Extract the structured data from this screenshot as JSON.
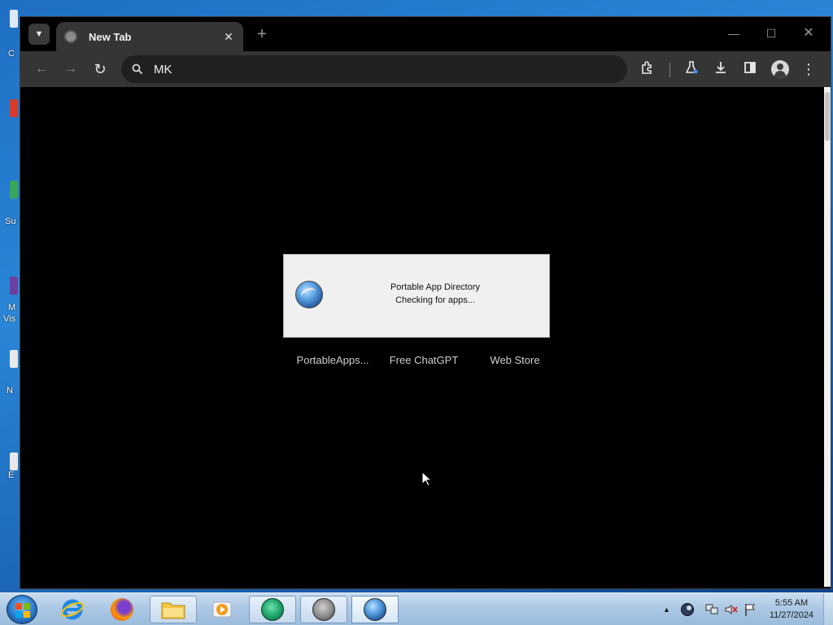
{
  "desktop": {
    "icons": [
      {
        "label": "C"
      },
      {
        "label": ""
      },
      {
        "label": "Su"
      },
      {
        "label": "M"
      },
      {
        "label": "Vis"
      },
      {
        "label": "N"
      },
      {
        "label": "E"
      }
    ]
  },
  "browser": {
    "tab": {
      "title": "New Tab",
      "close_label": "✕"
    },
    "new_tab_label": "+",
    "window_controls": {
      "minimize": "—",
      "maximize": "☐",
      "close": "✕"
    },
    "nav": {
      "back": "←",
      "forward": "→",
      "reload": "↻"
    },
    "omnibox": {
      "value": "MK",
      "search_glyph": "⚲"
    },
    "toolbar_icons": {
      "extensions": "⧉",
      "labs": "⚗",
      "downloads": "⤓",
      "side_panel": "◧",
      "menu": "⋮"
    },
    "shortcuts": [
      {
        "label": "PortableApps..."
      },
      {
        "label": "Free ChatGPT"
      },
      {
        "label": "Web Store"
      }
    ]
  },
  "dialog": {
    "title": "Portable App Directory",
    "message": "Checking for apps..."
  },
  "taskbar": {
    "apps": [
      {
        "name": "Internet Explorer",
        "icon": "ie-icon"
      },
      {
        "name": "Firefox",
        "icon": "firefox-icon"
      },
      {
        "name": "File Explorer",
        "icon": "folder-icon"
      },
      {
        "name": "Media Player",
        "icon": "media-player-icon"
      },
      {
        "name": "Portable Browser",
        "icon": "browser-app-icon"
      },
      {
        "name": "Sync App",
        "icon": "sync-icon"
      },
      {
        "name": "PortableApps Platform",
        "icon": "portableapps-icon"
      }
    ],
    "tray": {
      "show_hidden": "▲"
    },
    "clock": {
      "time": "5:55 AM",
      "date": "11/27/2024"
    }
  },
  "colors": {
    "window_bg": "#000000",
    "toolbar_bg": "#353535",
    "tab_bg": "#353535",
    "omnibox_bg": "#202020",
    "dialog_bg": "#f0f0f0",
    "taskbar_bg": "#aac7e4"
  }
}
